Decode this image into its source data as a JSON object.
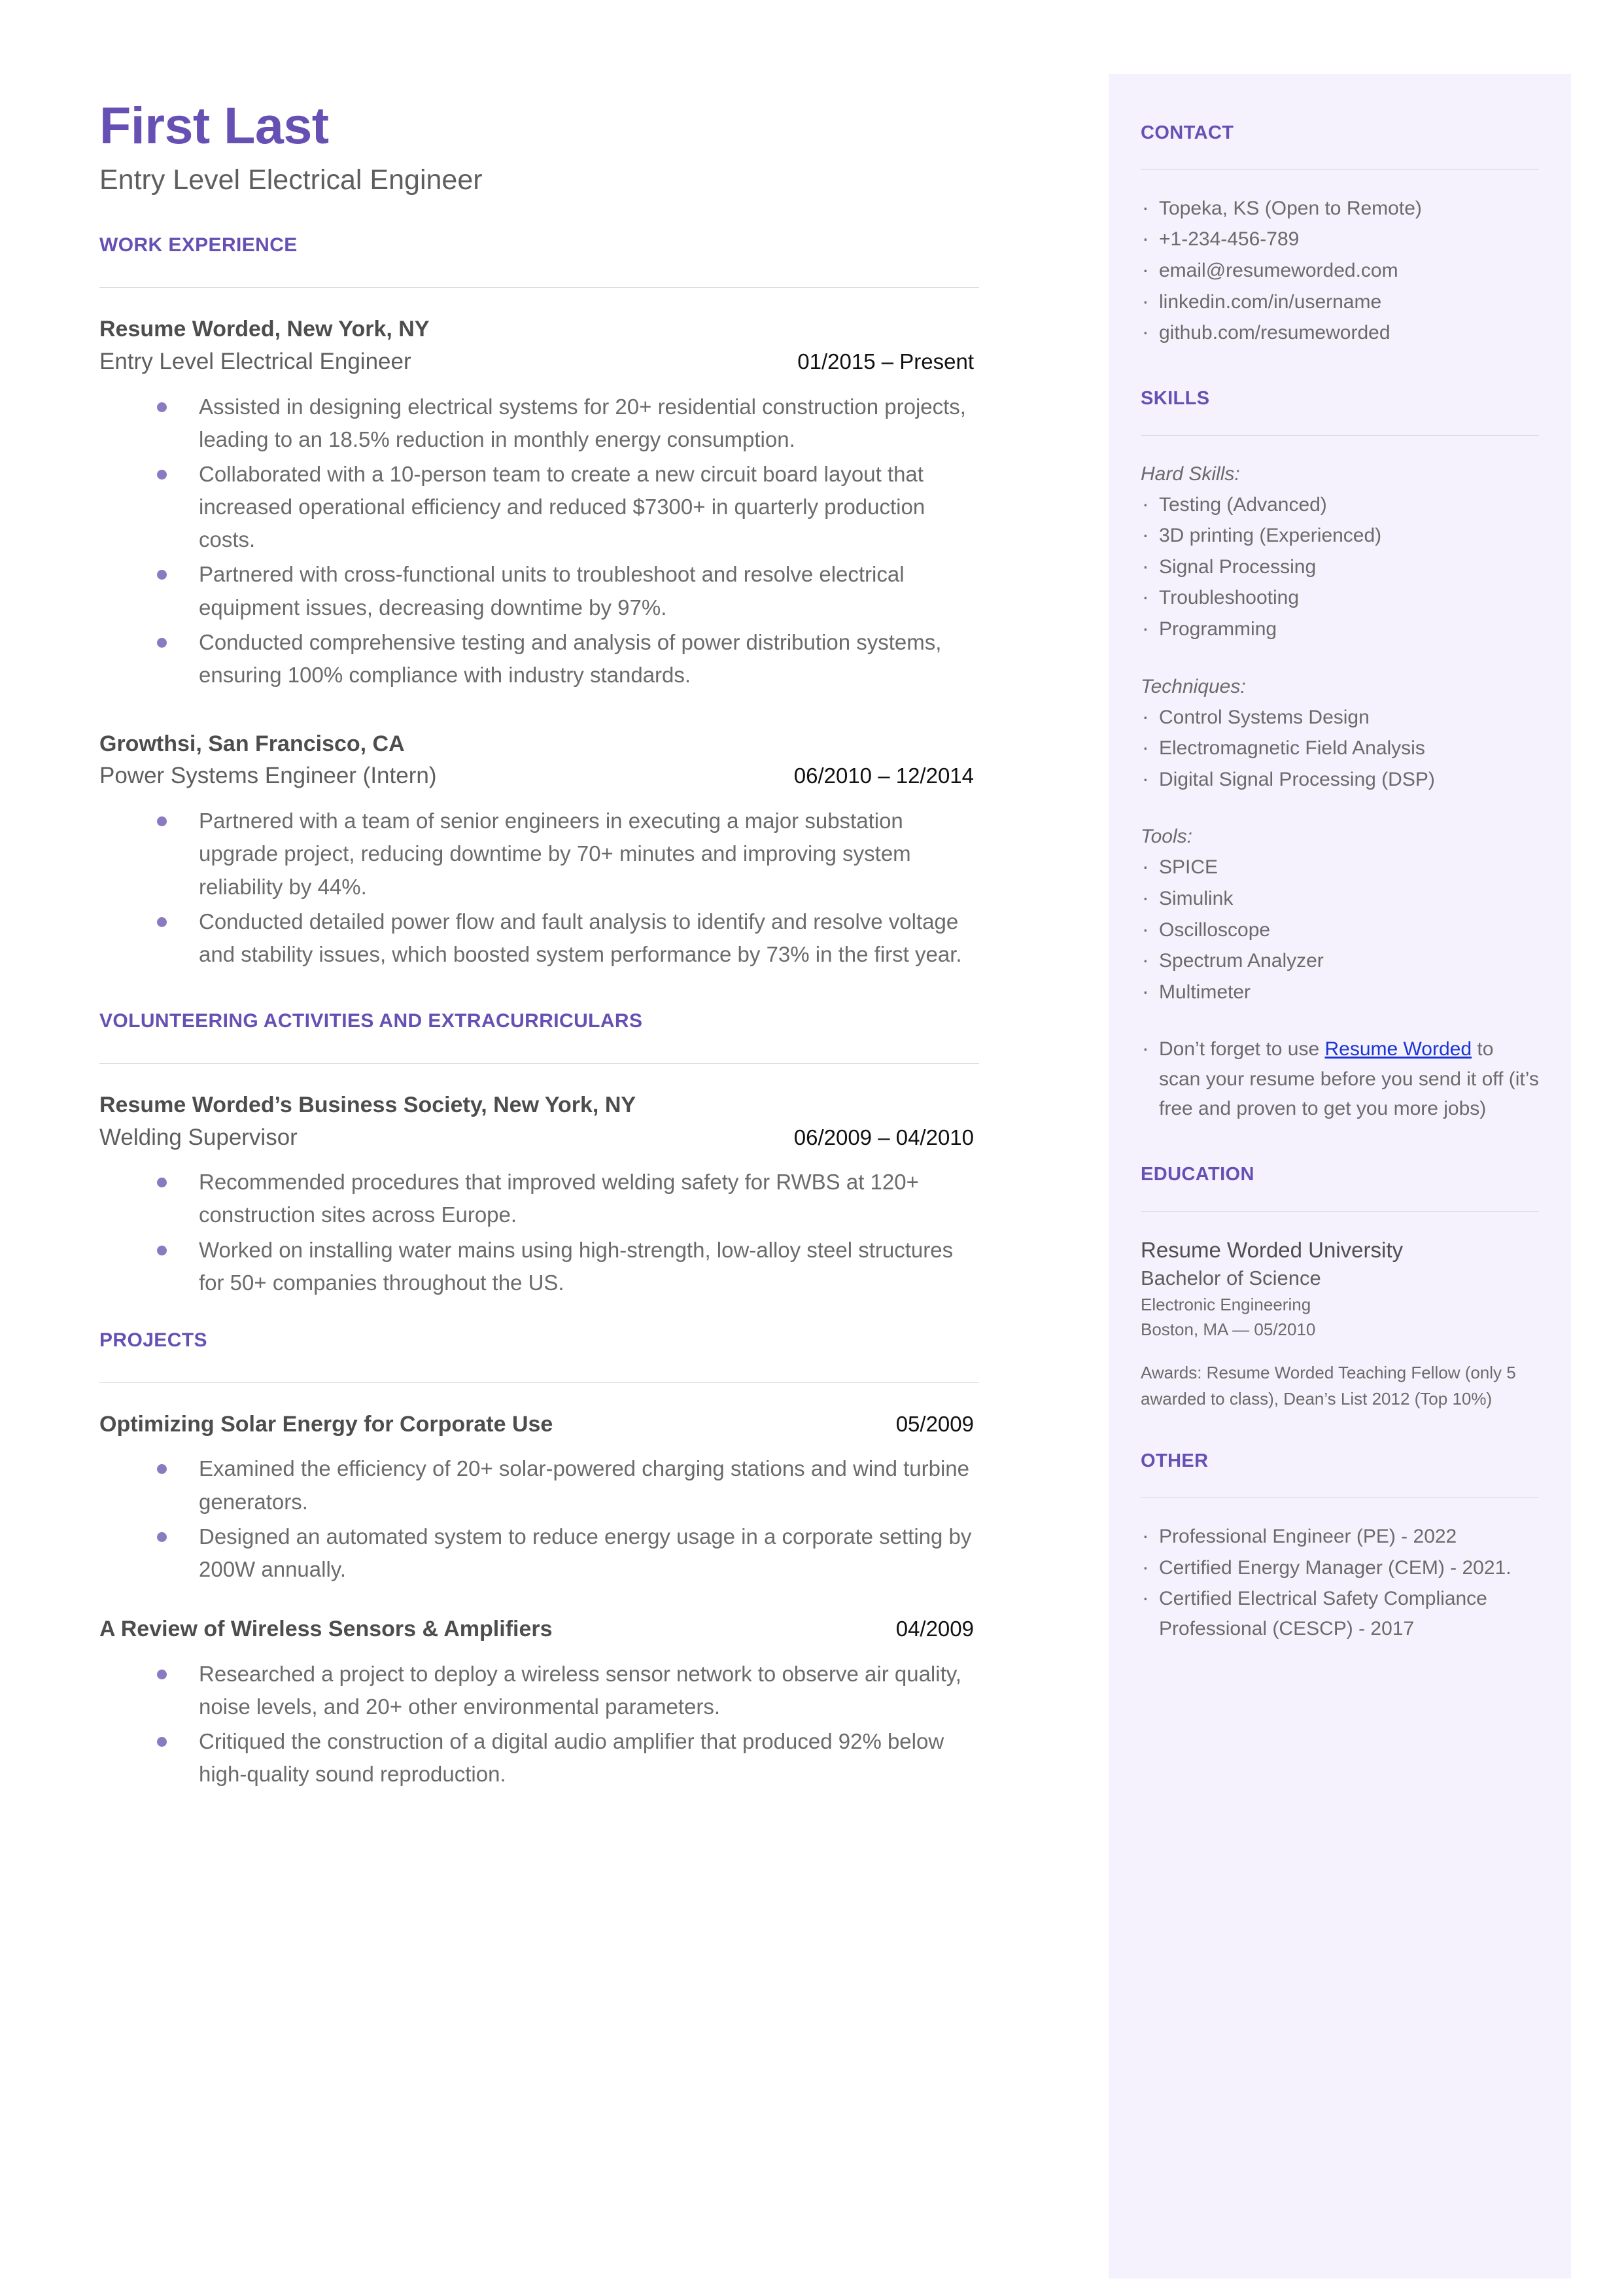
{
  "colors": {
    "accent_purple": "#6750b4",
    "bullet_purple": "#8a7ac0",
    "sidebar_bg": "#f5f2fd",
    "body_text": "#6b6b6b",
    "link_blue": "#1a35d6"
  },
  "header": {
    "name": "First Last",
    "headline": "Entry Level Electrical Engineer"
  },
  "sections": {
    "work_experience": {
      "title": "WORK EXPERIENCE",
      "entries": [
        {
          "org": "Resume Worded, New York, NY",
          "role": "Entry Level Electrical Engineer",
          "date": "01/2015 – Present",
          "bullets": [
            "Assisted in designing electrical systems for 20+ residential construction projects, leading to an 18.5% reduction in monthly energy consumption.",
            "Collaborated with a 10-person team to create a new circuit board layout that increased operational efficiency and reduced $7300+ in quarterly production costs.",
            "Partnered with cross-functional units to troubleshoot and resolve electrical equipment issues, decreasing downtime by 97%.",
            "Conducted comprehensive testing and analysis of power distribution systems, ensuring 100% compliance with industry standards."
          ]
        },
        {
          "org": "Growthsi, San Francisco, CA",
          "role": "Power Systems Engineer (Intern)",
          "date": "06/2010 – 12/2014",
          "bullets": [
            "Partnered with a team of senior engineers in executing a major substation upgrade project, reducing downtime by 70+ minutes and improving system reliability by 44%.",
            "Conducted detailed power flow and fault analysis to identify and resolve voltage and stability issues, which boosted system performance by 73% in the first year."
          ]
        }
      ]
    },
    "volunteering": {
      "title": "VOLUNTEERING ACTIVITIES AND EXTRACURRICULARS",
      "entries": [
        {
          "org": "Resume Worded’s Business Society, New York, NY",
          "role": "Welding Supervisor",
          "date": "06/2009 – 04/2010",
          "bullets": [
            "Recommended procedures that improved welding safety for RWBS at 120+ construction sites across Europe.",
            "Worked on installing water mains using high-strength, low-alloy steel structures for 50+ companies throughout the US."
          ]
        }
      ]
    },
    "projects": {
      "title": "PROJECTS",
      "entries": [
        {
          "title": "Optimizing Solar Energy for Corporate Use",
          "date": "05/2009",
          "bullets": [
            "Examined the efficiency of 20+ solar-powered charging stations and wind turbine generators.",
            "Designed an automated system to reduce energy usage in a corporate setting by 200W annually."
          ]
        },
        {
          "title": "A Review of Wireless Sensors & Amplifiers",
          "date": "04/2009",
          "bullets": [
            "Researched a project to deploy a wireless sensor network to observe air quality, noise levels, and 20+ other environmental parameters.",
            "Critiqued the construction of a digital audio amplifier that produced 92% below high-quality sound reproduction."
          ]
        }
      ]
    }
  },
  "sidebar": {
    "contact": {
      "title": "CONTACT",
      "items": [
        "Topeka, KS (Open to Remote)",
        "+1-234-456-789",
        "email@resumeworded.com",
        "linkedin.com/in/username",
        "github.com/resumeworded"
      ]
    },
    "skills": {
      "title": "SKILLS",
      "groups": [
        {
          "label": "Hard Skills:",
          "items": [
            "Testing (Advanced)",
            "3D printing (Experienced)",
            "Signal Processing",
            "Troubleshooting",
            "Programming"
          ]
        },
        {
          "label": "Techniques:",
          "items": [
            "Control Systems Design",
            "Electromagnetic Field Analysis",
            "Digital Signal Processing (DSP)"
          ]
        },
        {
          "label": "Tools:",
          "items": [
            "SPICE",
            "Simulink",
            "Oscilloscope",
            "Spectrum Analyzer",
            "Multimeter"
          ]
        }
      ],
      "promo": {
        "before": "Don’t forget to use ",
        "link": "Resume Worded",
        "after": " to scan your resume before you send it off (it’s free and proven to get you more jobs)"
      }
    },
    "education": {
      "title": "EDUCATION",
      "school": "Resume Worded University",
      "degree": "Bachelor of Science",
      "field": "Electronic Engineering",
      "location_date": "Boston, MA — 05/2010",
      "awards": "Awards: Resume Worded Teaching Fellow (only 5 awarded to class), Dean’s List 2012 (Top 10%)"
    },
    "other": {
      "title": "OTHER",
      "items": [
        "Professional Engineer (PE) - 2022",
        "Certified Energy Manager (CEM) - 2021.",
        "Certified Electrical Safety Compliance Professional (CESCP) - 2017"
      ]
    }
  }
}
